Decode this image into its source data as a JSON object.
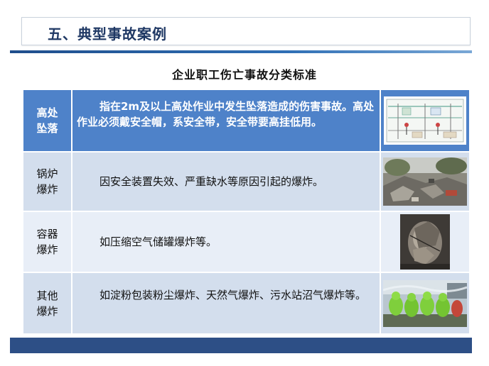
{
  "header": {
    "title": "五、典型事故案例"
  },
  "table": {
    "title": "企业职工伤亡事故分类标准",
    "rows": [
      {
        "label": "高处坠落",
        "desc": "指在2m及以上高处作业中发生坠落造成的伤害事故。高处作业必须戴安全帽，系安全带，安全带要高挂低用。",
        "image": "scaffold-diagram"
      },
      {
        "label": "锅炉爆炸",
        "desc": "因安全装置失效、严重缺水等原因引起的爆炸。",
        "image": "explosion-debris-photo"
      },
      {
        "label": "容器爆炸",
        "desc": "如压缩空气储罐爆炸等。",
        "image": "ruptured-tank-photo"
      },
      {
        "label": "其他爆炸",
        "desc": "如淀粉包装粉尘爆炸、天然气爆炸、污水站沼气爆炸等。",
        "image": "hazmat-responders-photo"
      }
    ]
  },
  "colors": {
    "title": "#1f3864",
    "highlight_row": "#4e82c9",
    "row_dark": "#d3deed",
    "row_light": "#e8eef7",
    "bar": "#2d4f86"
  }
}
